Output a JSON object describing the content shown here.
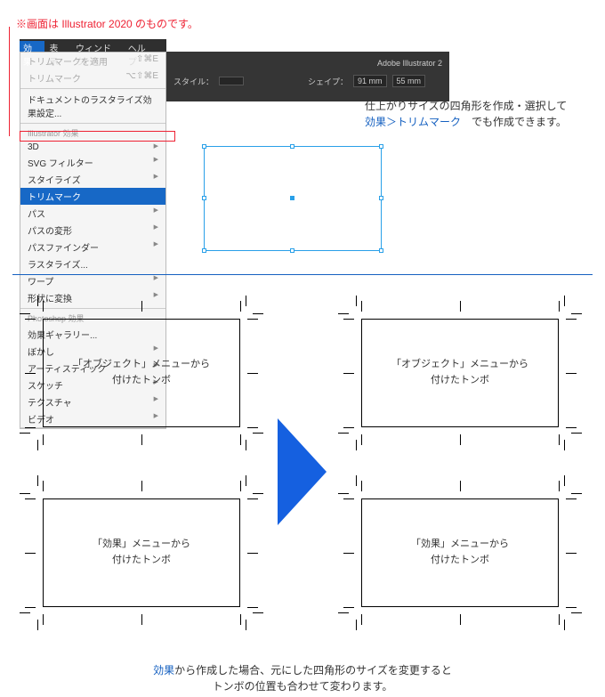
{
  "caption": "※画面は Illustrator 2020 のものです。",
  "app_title": "Adobe Illustrator 2",
  "menubar": {
    "effect": "効果",
    "view": "表示",
    "window": "ウィンドウ",
    "help": "ヘルプ"
  },
  "toolbar": {
    "style_label": "スタイル：",
    "shape_label": "シェイプ：",
    "w": "91 mm",
    "h": "55 mm"
  },
  "menu": {
    "apply_trim": "トリムマークを適用",
    "apply_trim_sc": "⇧⌘E",
    "trim": "トリムマーク",
    "trim_sc": "⌥⇧⌘E",
    "raster": "ドキュメントのラスタライズ効果設定...",
    "head_ai": "Illustrator 効果",
    "threeD": "3D",
    "svg": "SVG フィルター",
    "stylize": "スタイライズ",
    "trimmarks": "トリムマーク",
    "path": "パス",
    "distort": "パスの変形",
    "pathfinder": "パスファインダー",
    "rasterize": "ラスタライズ...",
    "warp": "ワープ",
    "convert": "形状に変換",
    "head_ps": "Photoshop 効果",
    "gallery": "効果ギャラリー...",
    "blur": "ぼかし",
    "artistic": "アーティスティック",
    "sketch": "スケッチ",
    "texture": "テクスチャ",
    "video": "ビデオ"
  },
  "side": {
    "l1": "仕上がりサイズの四角形を作成・選択して",
    "l2a": "効果＞トリムマーク",
    "l2b": "　でも作成できます。"
  },
  "cards": {
    "obj_l1": "「オブジェクト」メニューから",
    "obj_l2": "付けたトンボ",
    "eff_l1": "「効果」メニューから",
    "eff_l2": "付けたトンボ"
  },
  "bottom": {
    "a": "効果",
    "b": "から作成した場合、元にした四角形のサイズを変更すると",
    "c": "トンボの位置も合わせて変わります。"
  }
}
